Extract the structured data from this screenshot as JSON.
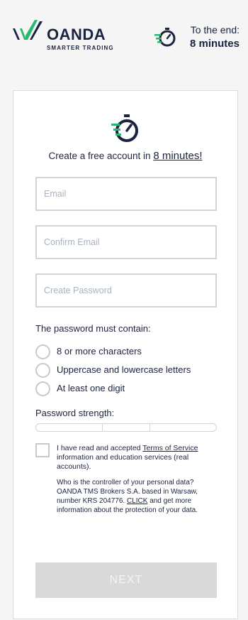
{
  "header": {
    "brand": "OANDA",
    "tagline": "SMARTER TRADING",
    "timer_label": "To the end:",
    "timer_value": "8 minutes",
    "colors": {
      "brand_navy": "#1c2340",
      "accent_green": "#33b26b"
    }
  },
  "form": {
    "intro_text": "Create a free account in",
    "intro_link": "8 minutes!",
    "email_placeholder": "Email",
    "confirm_email_placeholder": "Confirm Email",
    "password_placeholder": "Create Password",
    "requirements_title": "The password must contain:",
    "requirements": [
      "8 or more characters",
      "Uppercase and lowercase letters",
      "At least one digit"
    ],
    "strength_label": "Password strength:",
    "strength_value": 0,
    "terms_prefix": "I have read and accepted",
    "terms_link": "Terms of Service",
    "terms_suffix": "information and education services (real accounts).",
    "privacy_text": "Who is the controller of your personal data? OANDA TMS Brokers S.A. based in Warsaw, number KRS 204776.",
    "privacy_link": "CLICK",
    "privacy_suffix": "and get more information about the protection of your data.",
    "next_label": "NEXT"
  }
}
